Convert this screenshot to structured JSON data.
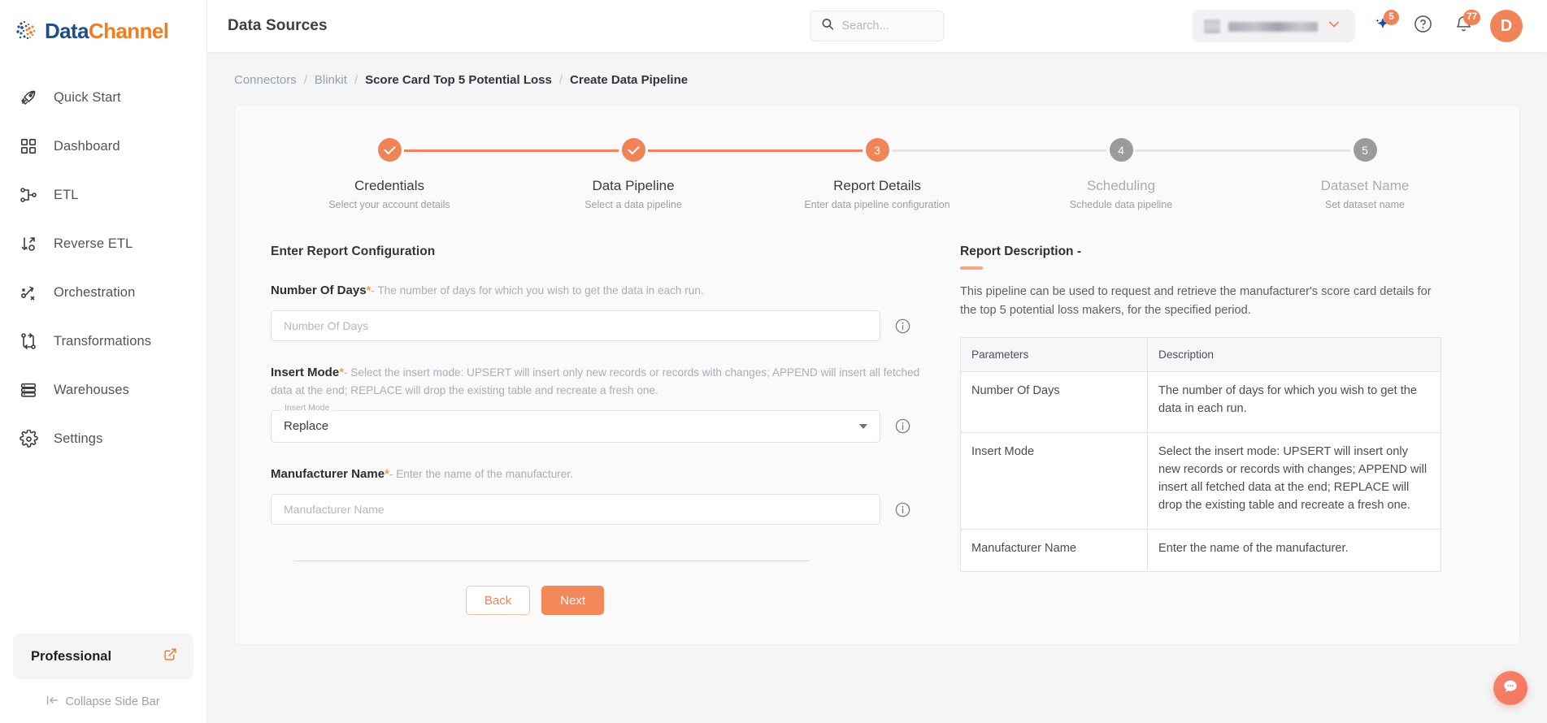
{
  "brand": {
    "name_part1": "Data",
    "name_part2": "Channel",
    "accent": "#f08458",
    "logo_blue": "#1f4e8c",
    "logo_orange": "#f47b20"
  },
  "sidebar": {
    "items": [
      {
        "label": "Quick Start",
        "icon": "rocket-icon"
      },
      {
        "label": "Dashboard",
        "icon": "grid-icon"
      },
      {
        "label": "ETL",
        "icon": "etl-icon"
      },
      {
        "label": "Reverse ETL",
        "icon": "reverse-etl-icon"
      },
      {
        "label": "Orchestration",
        "icon": "orchestration-icon"
      },
      {
        "label": "Transformations",
        "icon": "transformations-icon"
      },
      {
        "label": "Warehouses",
        "icon": "warehouse-icon"
      },
      {
        "label": "Settings",
        "icon": "gear-icon"
      }
    ],
    "plan": {
      "label": "Professional",
      "icon": "external-link-icon"
    },
    "collapse": {
      "label": "Collapse Side Bar",
      "icon": "collapse-left-icon"
    }
  },
  "topbar": {
    "title": "Data Sources",
    "search": {
      "placeholder": "Search...",
      "value": "",
      "icon": "search-icon"
    },
    "account_selector": {
      "value": "",
      "redacted": true,
      "icon": "chevron-down-icon"
    },
    "ai_badge": "5",
    "notifications_badge": "77",
    "help_icon": "question-circle-icon",
    "bell_icon": "bell-icon",
    "sparkle_icon": "sparkle-icon",
    "avatar_initial": "D"
  },
  "breadcrumb": [
    {
      "label": "Connectors",
      "active": false
    },
    {
      "label": "Blinkit",
      "active": false
    },
    {
      "label": "Score Card Top 5 Potential Loss",
      "active": true
    },
    {
      "label": "Create Data Pipeline",
      "active": true
    }
  ],
  "stepper": {
    "steps": [
      {
        "number": "1",
        "title": "Credentials",
        "subtitle": "Select your account details",
        "state": "done"
      },
      {
        "number": "2",
        "title": "Data Pipeline",
        "subtitle": "Select a data pipeline",
        "state": "done"
      },
      {
        "number": "3",
        "title": "Report Details",
        "subtitle": "Enter data pipeline configuration",
        "state": "current"
      },
      {
        "number": "4",
        "title": "Scheduling",
        "subtitle": "Schedule data pipeline",
        "state": "future"
      },
      {
        "number": "5",
        "title": "Dataset Name",
        "subtitle": "Set dataset name",
        "state": "future"
      }
    ]
  },
  "form": {
    "section_title": "Enter Report Configuration",
    "fields": [
      {
        "label": "Number Of Days",
        "required_mark": "*",
        "hint": "- The number of days for which you wish to get the data in each run.",
        "type": "text",
        "placeholder": "Number Of Days",
        "value": "",
        "info_icon": "info-icon"
      },
      {
        "label": "Insert Mode",
        "required_mark": "*",
        "hint": "- Select the insert mode: UPSERT will insert only new records or records with changes; APPEND will insert all fetched data at the end; REPLACE will drop the existing table and recreate a fresh one.",
        "type": "select",
        "float_label": "Insert Mode",
        "value": "Replace",
        "info_icon": "info-icon"
      },
      {
        "label": "Manufacturer Name",
        "required_mark": "*",
        "hint": "- Enter the name of the manufacturer.",
        "type": "text",
        "placeholder": "Manufacturer Name",
        "value": "",
        "info_icon": "info-icon"
      }
    ],
    "buttons": {
      "back": "Back",
      "next": "Next"
    }
  },
  "report_description": {
    "title": "Report Description -",
    "text": "This pipeline can be used to request and retrieve the manufacturer's score card details for the top 5 potential loss makers, for the specified period.",
    "table": {
      "headers": [
        "Parameters",
        "Description"
      ],
      "rows": [
        {
          "parameter": "Number Of Days",
          "description": "The number of days for which you wish to get the data in each run."
        },
        {
          "parameter": "Insert Mode",
          "description": "Select the insert mode: UPSERT will insert only new records or records with changes; APPEND will insert all fetched data at the end; REPLACE will drop the existing table and recreate a fresh one."
        },
        {
          "parameter": "Manufacturer Name",
          "description": "Enter the name of the manufacturer."
        }
      ]
    }
  },
  "fab": {
    "icon": "chat-bubble-icon"
  }
}
